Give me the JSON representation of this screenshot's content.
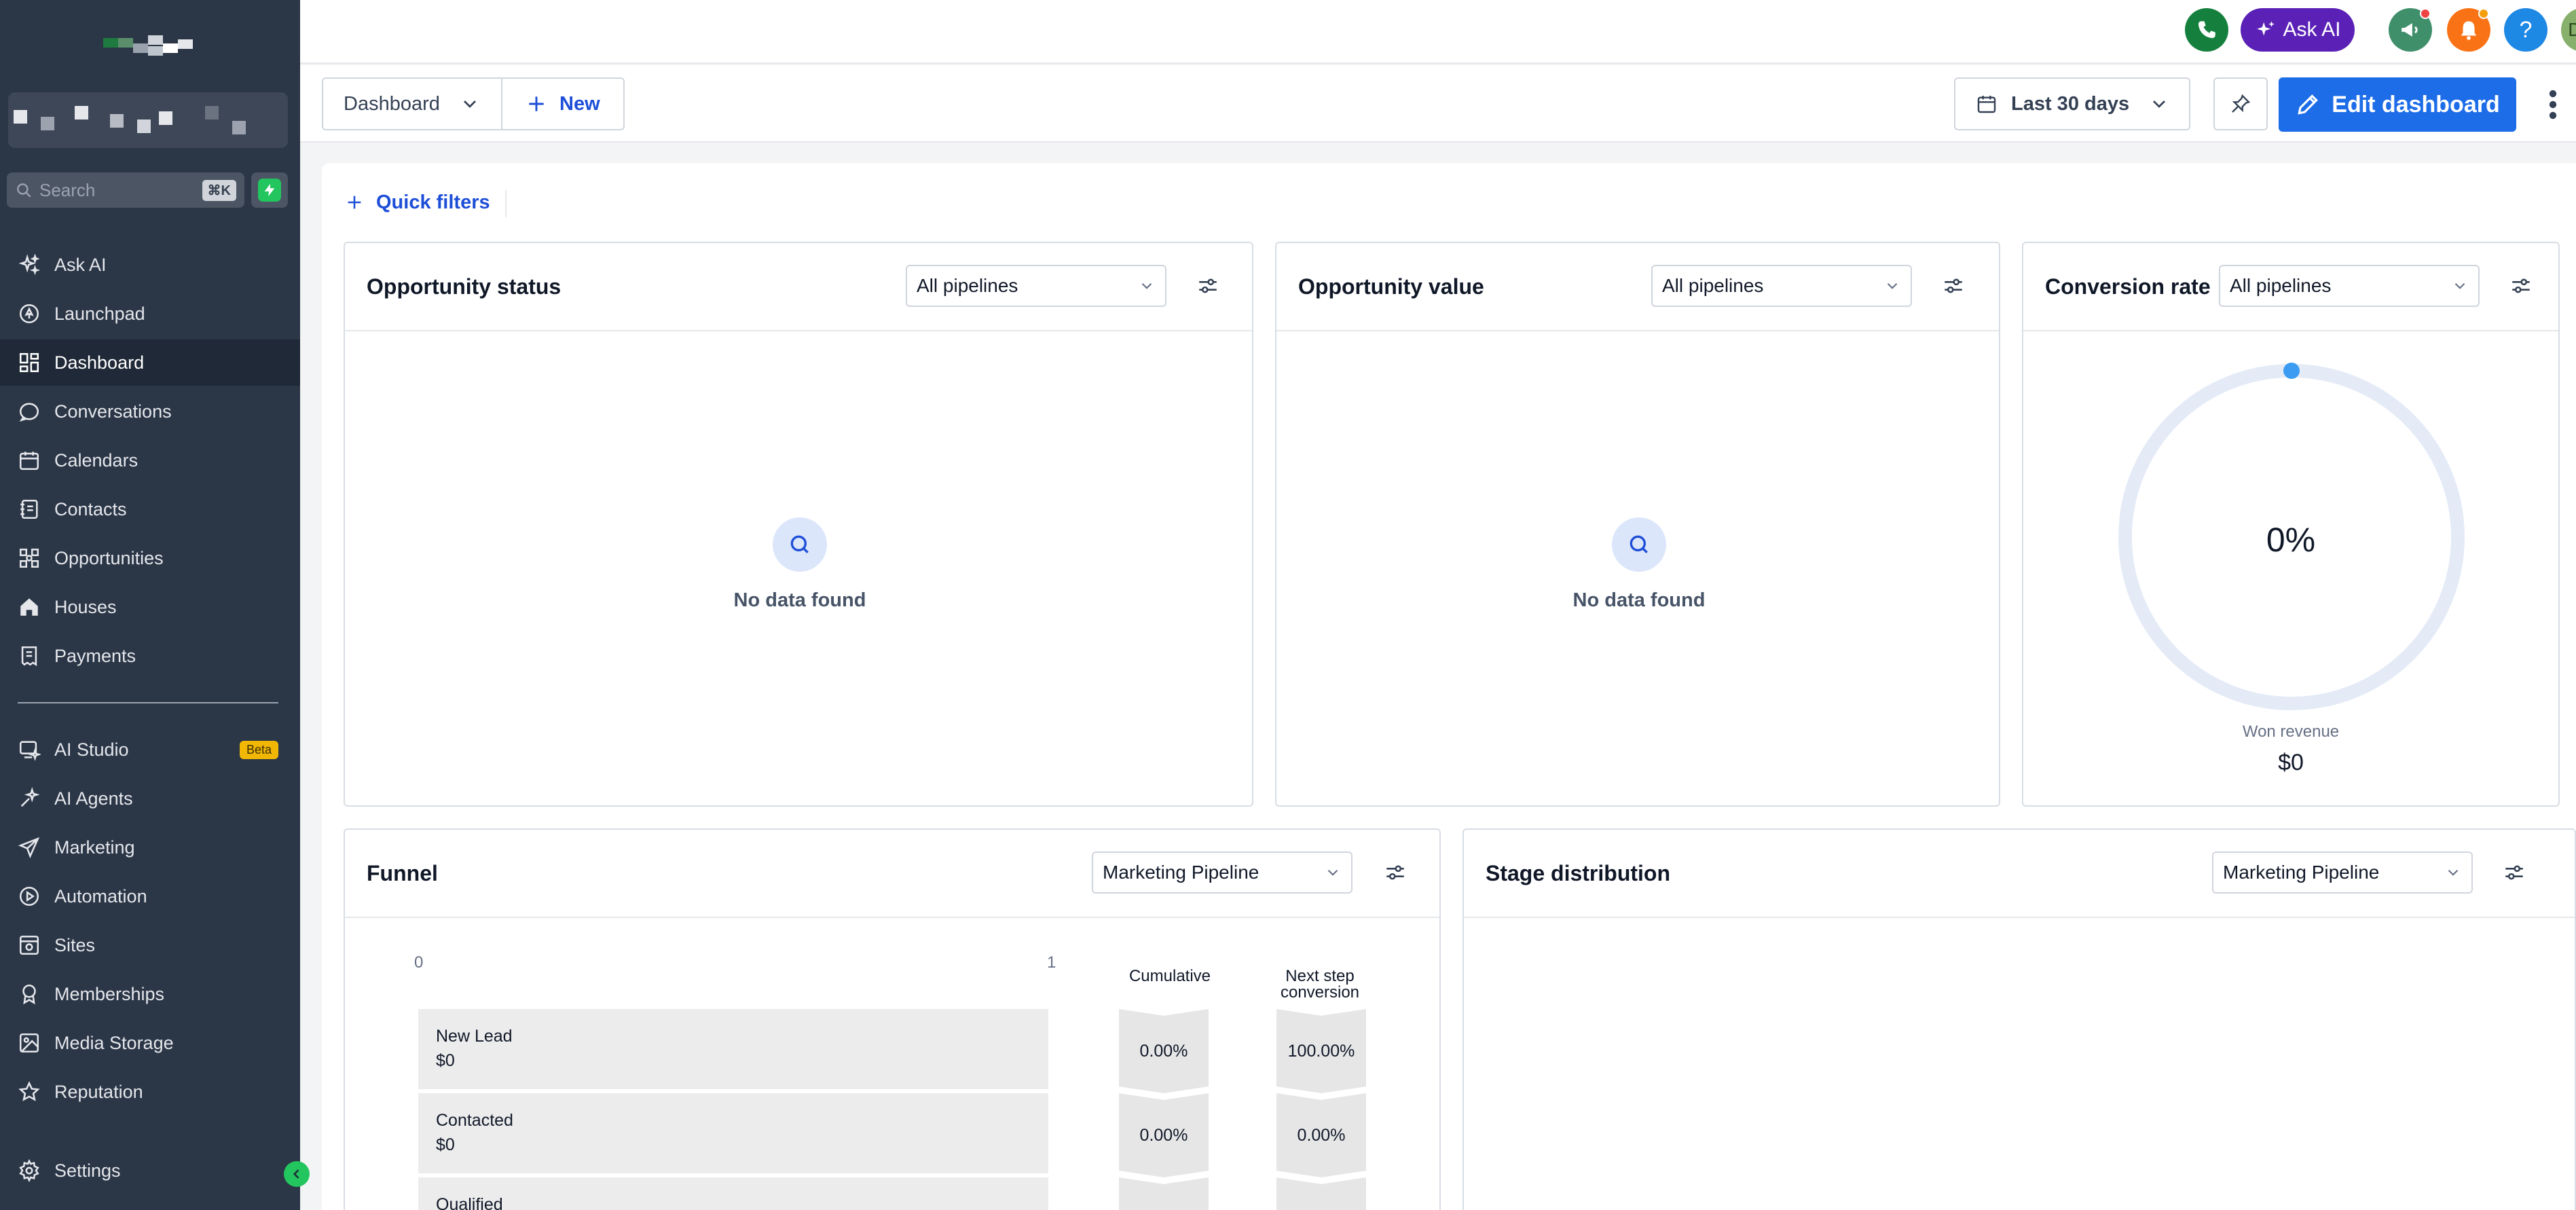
{
  "sidebar": {
    "search_placeholder": "Search",
    "search_shortcut": "⌘K",
    "items": [
      {
        "label": "Ask AI",
        "icon": "sparkle-icon"
      },
      {
        "label": "Launchpad",
        "icon": "rocket-icon"
      },
      {
        "label": "Dashboard",
        "icon": "grid-icon",
        "active": true
      },
      {
        "label": "Conversations",
        "icon": "chat-icon"
      },
      {
        "label": "Calendars",
        "icon": "calendar-icon"
      },
      {
        "label": "Contacts",
        "icon": "contacts-icon"
      },
      {
        "label": "Opportunities",
        "icon": "opportunities-icon"
      },
      {
        "label": "Houses",
        "icon": "house-icon"
      },
      {
        "label": "Payments",
        "icon": "receipt-icon"
      }
    ],
    "items2": [
      {
        "label": "AI Studio",
        "icon": "ai-studio-icon",
        "badge": "Beta"
      },
      {
        "label": "AI Agents",
        "icon": "ai-agents-icon"
      },
      {
        "label": "Marketing",
        "icon": "send-icon"
      },
      {
        "label": "Automation",
        "icon": "automation-icon"
      },
      {
        "label": "Sites",
        "icon": "sites-icon"
      },
      {
        "label": "Memberships",
        "icon": "award-icon"
      },
      {
        "label": "Media Storage",
        "icon": "image-icon"
      },
      {
        "label": "Reputation",
        "icon": "star-icon"
      }
    ],
    "settings_label": "Settings"
  },
  "header": {
    "ask_ai_label": "Ask AI",
    "help_label": "?",
    "avatar_initials": "DM"
  },
  "toolbar": {
    "dashboard_label": "Dashboard",
    "new_label": "New",
    "date_range_label": "Last 30 days",
    "edit_label": "Edit dashboard"
  },
  "quick_filters_label": "Quick filters",
  "widgets": {
    "opportunity_status": {
      "title": "Opportunity status",
      "filter": "All pipelines",
      "empty_text": "No data found"
    },
    "opportunity_value": {
      "title": "Opportunity value",
      "filter": "All pipelines",
      "empty_text": "No data found"
    },
    "conversion_rate": {
      "title": "Conversion rate",
      "filter": "All pipelines",
      "value": "0%",
      "caption": "Won revenue",
      "amount": "$0",
      "rate": 0
    },
    "funnel": {
      "title": "Funnel",
      "filter": "Marketing Pipeline",
      "axis_min": "0",
      "axis_max": "1",
      "cumulative_label": "Cumulative",
      "next_step_label": "Next step conversion",
      "stages": [
        {
          "name": "New Lead",
          "value": "$0",
          "cumulative": "0.00%",
          "next": "100.00%"
        },
        {
          "name": "Contacted",
          "value": "$0",
          "cumulative": "0.00%",
          "next": "0.00%"
        },
        {
          "name": "Qualified",
          "value": "",
          "cumulative": "",
          "next": ""
        }
      ]
    },
    "stage_distribution": {
      "title": "Stage distribution",
      "filter": "Marketing Pipeline"
    }
  },
  "colors": {
    "sidebar_bg": "#2b3647",
    "primary": "#1d6ce8",
    "ask_ai": "#5b21b6",
    "phone": "#15803d",
    "notification": "#f97316",
    "help": "#1e88e5",
    "avatar": "#86b06b",
    "accent_green": "#22c55e"
  }
}
